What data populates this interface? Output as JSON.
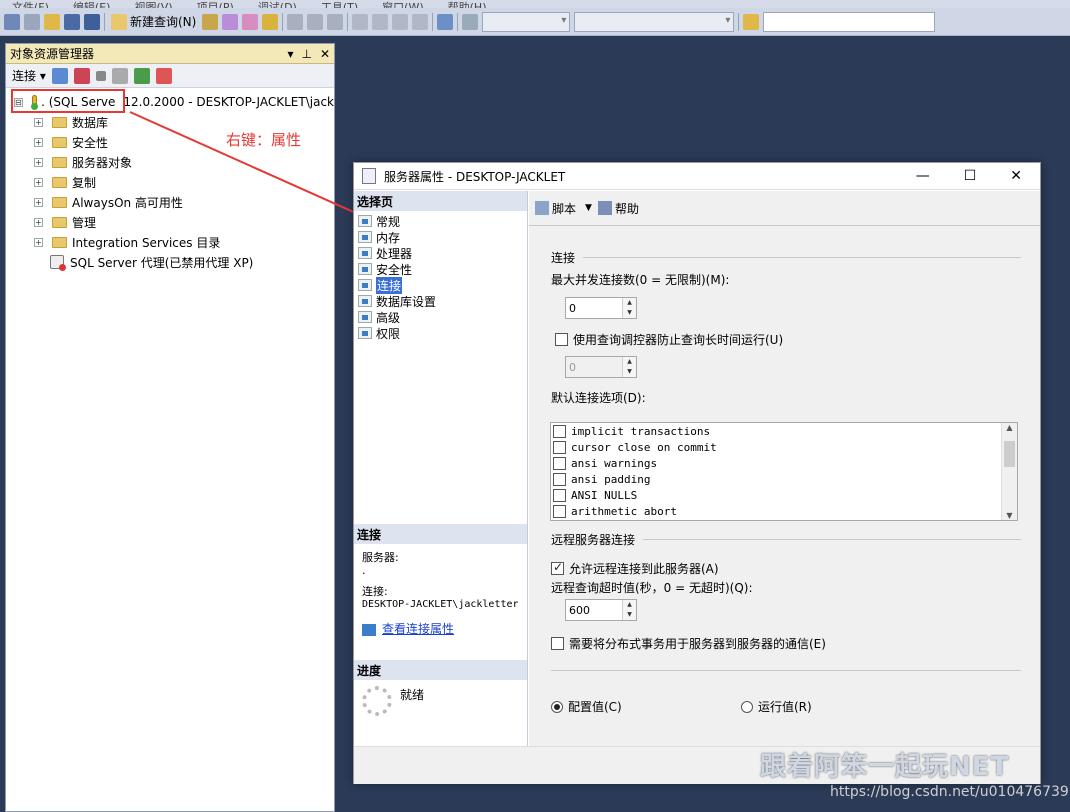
{
  "menubar": [
    "文件(F)",
    "编辑(E)",
    "视图(V)",
    "项目(P)",
    "调试(D)",
    "工具(T)",
    "窗口(W)",
    "帮助(H)"
  ],
  "toolbar": {
    "new_query": "新建查询(N)"
  },
  "object_explorer": {
    "title": "对象资源管理器",
    "title_controls": [
      "▾",
      "⊥",
      "✕"
    ],
    "connect_label": "连接",
    "root": {
      "name": ". (SQL Serve",
      "suffix": "12.0.2000 - DESKTOP-JACKLET\\jack",
      "expand": "⊟"
    },
    "children": [
      {
        "label": "数据库"
      },
      {
        "label": "安全性"
      },
      {
        "label": "服务器对象"
      },
      {
        "label": "复制"
      },
      {
        "label": "AlwaysOn 高可用性"
      },
      {
        "label": "管理"
      },
      {
        "label": "Integration Services 目录"
      }
    ],
    "agent": "SQL Server 代理(已禁用代理 XP)"
  },
  "annotation": "右键：属性",
  "dialog": {
    "title": "服务器属性 - DESKTOP-JACKLET",
    "window_controls": [
      "—",
      "☐",
      "✕"
    ],
    "select_page_header": "选择页",
    "pages": [
      "常规",
      "内存",
      "处理器",
      "安全性",
      "连接",
      "数据库设置",
      "高级",
      "权限"
    ],
    "selected_page": 4,
    "connection_header": "连接",
    "server_label": "服务器:",
    "server_value": ".",
    "connection_label": "连接:",
    "connection_value": "DESKTOP-JACKLET\\jackletter",
    "view_conn_props": "查看连接属性",
    "progress_header": "进度",
    "progress_status": "就绪",
    "toolbar": {
      "script": "脚本",
      "help": "帮助"
    },
    "section_connection": "连接",
    "max_conn_label": "最大并发连接数(0 = 无限制)(M):",
    "max_conn_value": "0",
    "use_governor_label": "使用查询调控器防止查询长时间运行(U)",
    "governor_value": "0",
    "default_opts_label": "默认连接选项(D):",
    "options": [
      {
        "label": "implicit transactions",
        "checked": false
      },
      {
        "label": "cursor close on commit",
        "checked": false
      },
      {
        "label": "ansi warnings",
        "checked": false
      },
      {
        "label": "ansi padding",
        "checked": false
      },
      {
        "label": "ANSI NULLS",
        "checked": false
      },
      {
        "label": "arithmetic abort",
        "checked": false
      }
    ],
    "section_remote": "远程服务器连接",
    "allow_remote_label": "允许远程连接到此服务器(A)",
    "allow_remote_checked": true,
    "remote_timeout_label": "远程查询超时值(秒，0 = 无超时)(Q):",
    "remote_timeout_value": "600",
    "distributed_label": "需要将分布式事务用于服务器到服务器的通信(E)",
    "radio_configured": "配置值(C)",
    "radio_running": "运行值(R)"
  },
  "watermark": "跟着阿笨一起玩NET",
  "csdn": "https://blog.csdn.net/u010476739",
  "colors": {
    "annotation_red": "#e53935",
    "selected_blue": "#3a6fd8",
    "link_blue": "#1a3fcf"
  }
}
